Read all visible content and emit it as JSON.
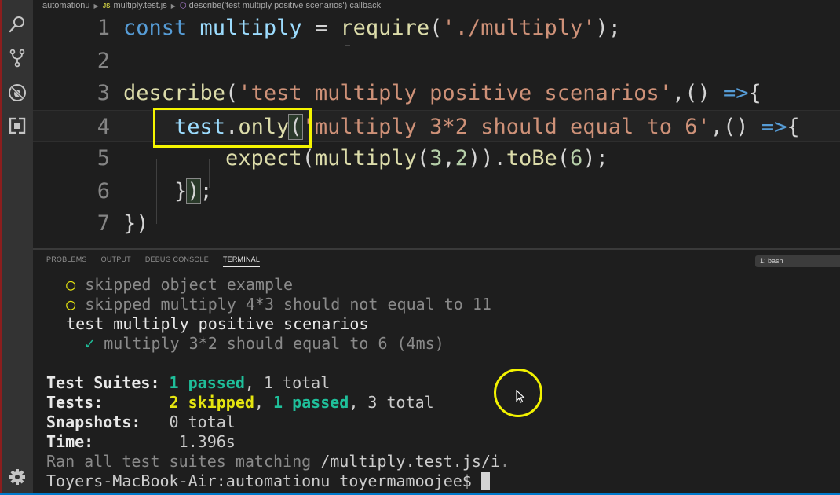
{
  "breadcrumb": {
    "folder": "automationu",
    "file_icon": "JS",
    "file": "multiply.test.js",
    "symbol": "describe('test multiply positive scenarios') callback"
  },
  "activity_bar": {
    "icons": [
      "search-icon",
      "source-control-icon",
      "debug-icon",
      "extensions-icon"
    ],
    "bottom_icon": "gear-icon"
  },
  "editor": {
    "lines": [
      {
        "number": "1",
        "tokens": [
          {
            "t": "const",
            "c": "kw"
          },
          {
            "t": " ",
            "c": "punc"
          },
          {
            "t": "multiply",
            "c": "var"
          },
          {
            "t": " = ",
            "c": "punc"
          },
          {
            "t": "require",
            "c": "fn"
          },
          {
            "t": "(",
            "c": "punc"
          },
          {
            "t": "'./multiply'",
            "c": "str"
          },
          {
            "t": ");",
            "c": "punc"
          }
        ]
      },
      {
        "number": "2",
        "tokens": []
      },
      {
        "number": "3",
        "tokens": [
          {
            "t": "describe",
            "c": "fn"
          },
          {
            "t": "(",
            "c": "punc"
          },
          {
            "t": "'test multiply positive scenarios'",
            "c": "str"
          },
          {
            "t": ",() ",
            "c": "punc"
          },
          {
            "t": "=>",
            "c": "arrow"
          },
          {
            "t": "{",
            "c": "punc"
          }
        ]
      },
      {
        "number": "4",
        "tokens": [
          {
            "t": "    ",
            "c": "punc"
          },
          {
            "t": "test",
            "c": "var"
          },
          {
            "t": ".",
            "c": "punc"
          },
          {
            "t": "only",
            "c": "fn"
          },
          {
            "t": "(",
            "c": "bracket"
          },
          {
            "t": "'multiply 3*2 should equal to 6'",
            "c": "str"
          },
          {
            "t": ",() ",
            "c": "punc"
          },
          {
            "t": "=>",
            "c": "arrow"
          },
          {
            "t": "{",
            "c": "punc"
          }
        ]
      },
      {
        "number": "5",
        "tokens": [
          {
            "t": "        ",
            "c": "punc"
          },
          {
            "t": "expect",
            "c": "fn"
          },
          {
            "t": "(",
            "c": "punc"
          },
          {
            "t": "multiply",
            "c": "fn"
          },
          {
            "t": "(",
            "c": "punc"
          },
          {
            "t": "3",
            "c": "num"
          },
          {
            "t": ",",
            "c": "punc"
          },
          {
            "t": "2",
            "c": "num"
          },
          {
            "t": ")).",
            "c": "punc"
          },
          {
            "t": "toBe",
            "c": "fn"
          },
          {
            "t": "(",
            "c": "punc"
          },
          {
            "t": "6",
            "c": "num"
          },
          {
            "t": ");",
            "c": "punc"
          }
        ]
      },
      {
        "number": "6",
        "tokens": [
          {
            "t": "    }",
            "c": "punc"
          },
          {
            "t": ")",
            "c": "bracket"
          },
          {
            "t": ";",
            "c": "punc"
          }
        ]
      },
      {
        "number": "7",
        "tokens": [
          {
            "t": "})",
            "c": "punc"
          }
        ]
      }
    ],
    "current_line": 4
  },
  "panel": {
    "tabs": [
      "PROBLEMS",
      "OUTPUT",
      "DEBUG CONSOLE",
      "TERMINAL"
    ],
    "active_tab": "TERMINAL",
    "terminal_select": "1: bash"
  },
  "terminal": {
    "skipped_marker": "○",
    "pass_marker": "✓",
    "skipped_1": "skipped object example",
    "skipped_2": "skipped multiply 4*3 should not equal to 11",
    "suite_name": "test multiply positive scenarios",
    "passed_test": "multiply 3*2 should equal to 6 (4ms)",
    "summary": {
      "suites_label": "Test Suites:",
      "suites_passed": "1 passed",
      "suites_total": ", 1 total",
      "tests_label": "Tests:",
      "tests_skipped": "2 skipped",
      "tests_sep": ", ",
      "tests_passed": "1 passed",
      "tests_total": ", 3 total",
      "snapshots_label": "Snapshots:",
      "snapshots_value": "0 total",
      "time_label": "Time:",
      "time_value": "1.396s"
    },
    "ran_prefix": "Ran all test suites matching ",
    "ran_pattern": "/multiply.test.js/i",
    "ran_suffix": ".",
    "prompt": "Toyers-MacBook-Air:automationu toyermamoojee$ "
  },
  "colors": {
    "highlight_box": "#f5f500",
    "passed": "#1fbf9a",
    "skipped": "#e5e510"
  }
}
